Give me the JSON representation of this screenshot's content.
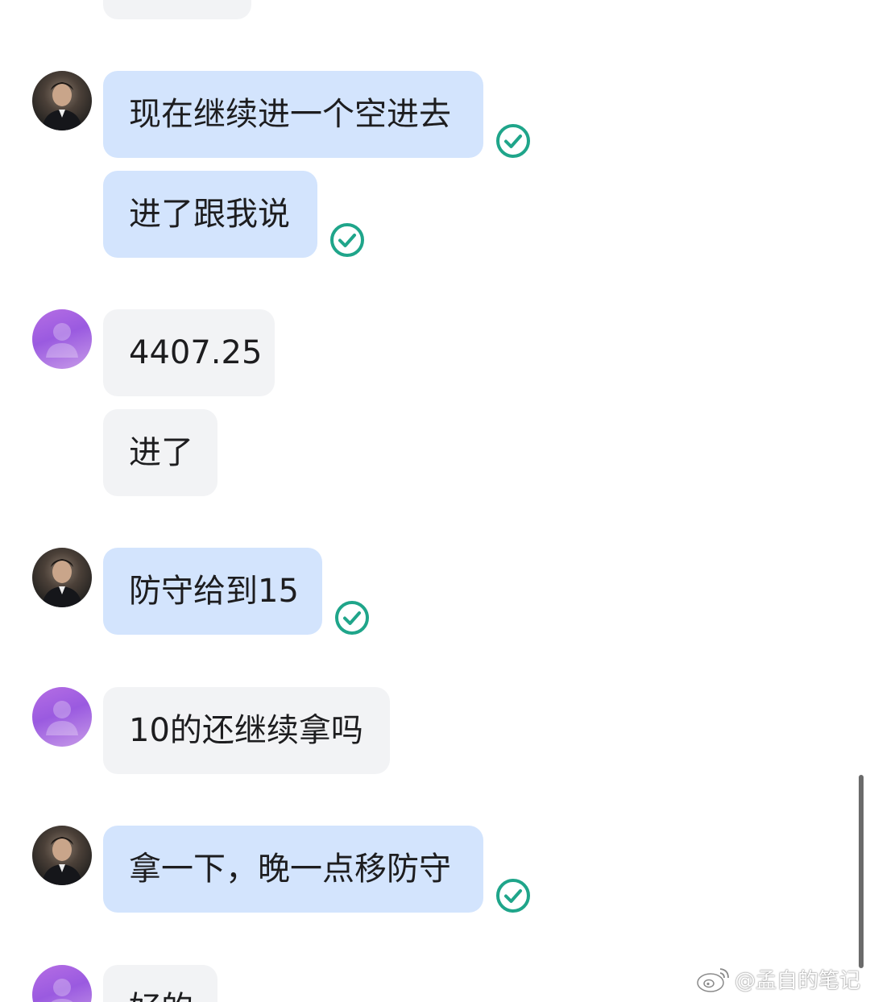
{
  "messages": [
    {
      "sender": "other",
      "text": ""
    },
    {
      "sender": "self",
      "text": "现在继续进一个空进去",
      "status": "read"
    },
    {
      "sender": "self",
      "text": "进了跟我说",
      "status": "read"
    },
    {
      "sender": "other",
      "text": "4407.25"
    },
    {
      "sender": "other",
      "text": "进了"
    },
    {
      "sender": "self",
      "text": "防守给到15",
      "status": "read"
    },
    {
      "sender": "other",
      "text": "10的还继续拿吗"
    },
    {
      "sender": "self",
      "text": "拿一下，晚一点移防守",
      "status": "read"
    },
    {
      "sender": "other",
      "text": "好的"
    }
  ],
  "icons": {
    "read_check": "check-circle-icon",
    "self_avatar": "avatar-photo",
    "other_avatar": "default-user-avatar",
    "watermark": "weibo-icon"
  },
  "colors": {
    "self_bubble": "#d3e4fd",
    "other_bubble": "#f2f3f5",
    "check": "#1fa58a",
    "other_avatar": "#a765e2"
  },
  "watermark": {
    "text": "@孟自的笔记"
  }
}
